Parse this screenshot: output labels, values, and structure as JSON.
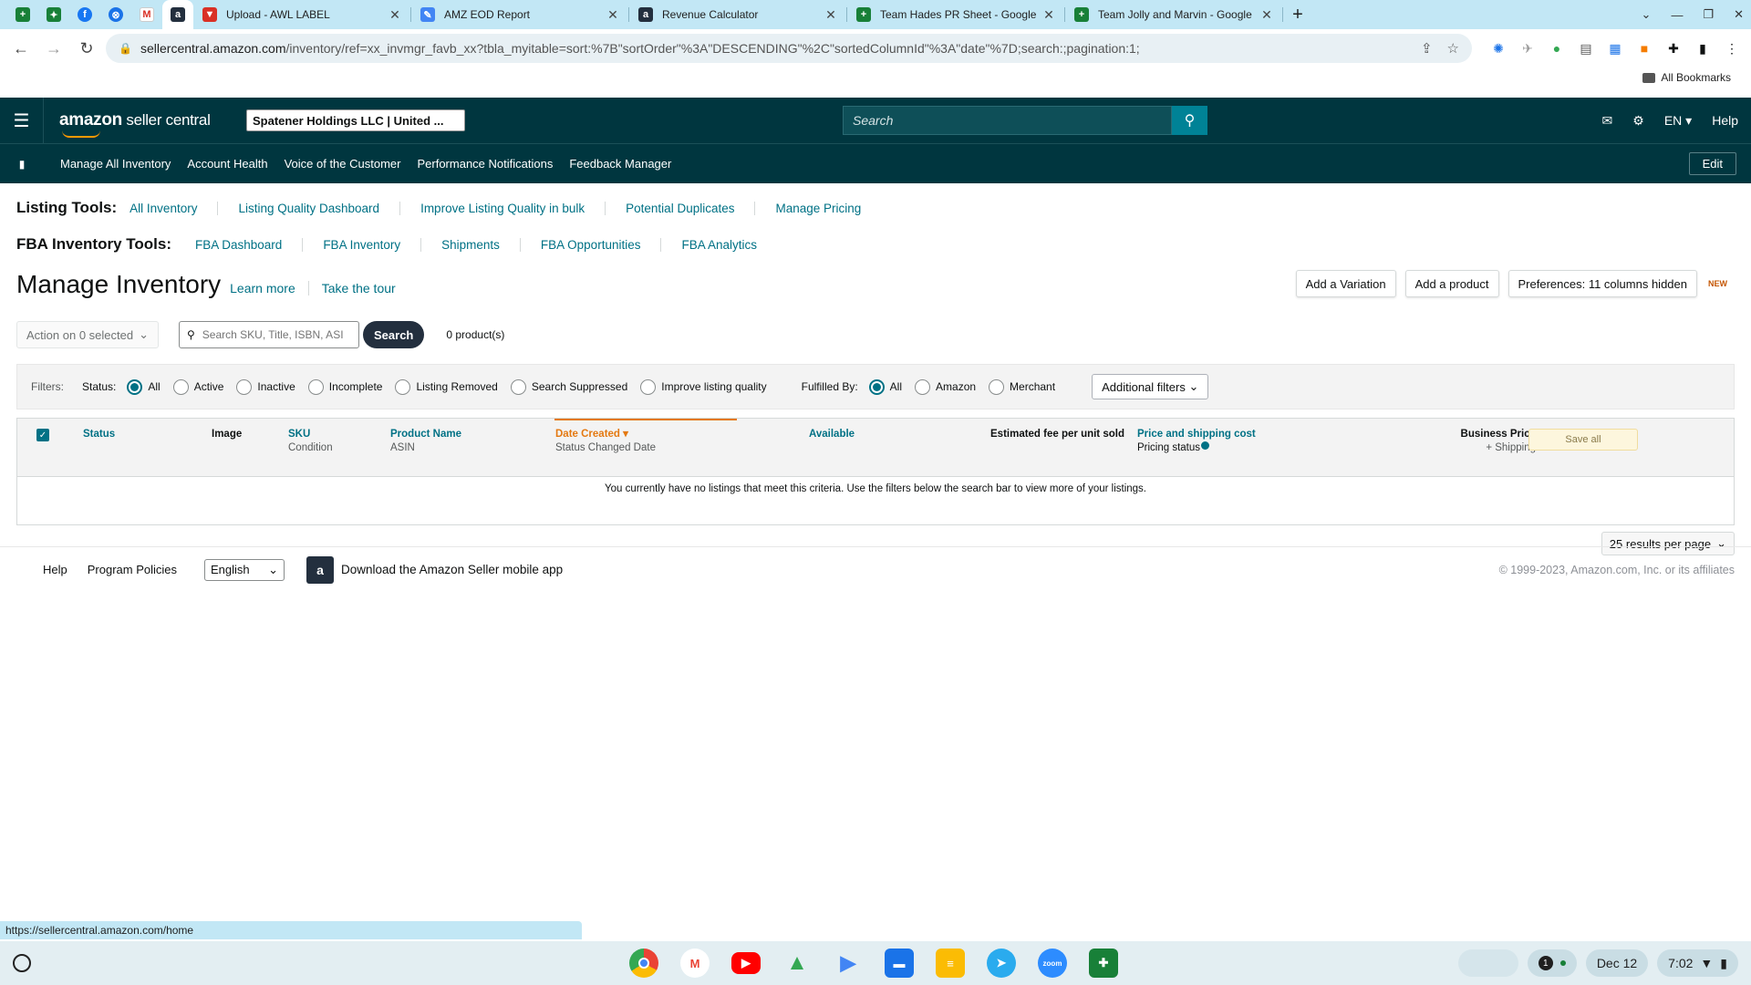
{
  "browser": {
    "tabs": [
      {
        "title": "Upload - AWL LABEL",
        "icon": "flag-icon",
        "color": "#d93025"
      },
      {
        "title": "AMZ EOD Report",
        "icon": "pen-icon",
        "color": "#4285f4"
      },
      {
        "title": "Revenue Calculator",
        "icon": "amazon-icon",
        "color": "#232f3e"
      },
      {
        "title": "Team Hades PR Sheet - Google",
        "icon": "sheets-icon",
        "color": "#188038"
      },
      {
        "title": "Team Jolly and Marvin - Google",
        "icon": "sheets-icon",
        "color": "#188038"
      }
    ],
    "url_domain": "sellercentral.amazon.com",
    "url_path": "/inventory/ref=xx_invmgr_favb_xx?tbla_myitable=sort:%7B\"sortOrder\"%3A\"DESCENDING\"%2C\"sortedColumnId\"%3A\"date\"%7D;search:;pagination:1;",
    "bookmarks_label": "All Bookmarks",
    "status_url": "https://sellercentral.amazon.com/home"
  },
  "header": {
    "logo_bold": "amazon",
    "logo_rest": " seller central",
    "store": "Spatener Holdings LLC | United ...",
    "search_placeholder": "Search",
    "lang": "EN",
    "help": "Help"
  },
  "nav": {
    "items": [
      "Manage All Inventory",
      "Account Health",
      "Voice of the Customer",
      "Performance Notifications",
      "Feedback Manager"
    ],
    "edit": "Edit"
  },
  "listing_tools": {
    "label": "Listing Tools:",
    "links": [
      "All Inventory",
      "Listing Quality Dashboard",
      "Improve Listing Quality in bulk",
      "Potential Duplicates",
      "Manage Pricing"
    ]
  },
  "fba_tools": {
    "label": "FBA Inventory Tools:",
    "links": [
      "FBA Dashboard",
      "FBA Inventory",
      "Shipments",
      "FBA Opportunities",
      "FBA Analytics"
    ]
  },
  "page": {
    "title": "Manage Inventory",
    "learn_more": "Learn more",
    "take_tour": "Take the tour",
    "add_variation": "Add a Variation",
    "add_product": "Add a product",
    "preferences": "Preferences: 11 columns hidden",
    "new_badge": "NEW",
    "action_select": "Action on 0 selected",
    "search_placeholder": "Search SKU, Title, ISBN, ASI",
    "search_btn": "Search",
    "product_count": "0 product(s)"
  },
  "filters": {
    "label": "Filters:",
    "status_label": "Status:",
    "status_options": [
      "All",
      "Active",
      "Inactive",
      "Incomplete",
      "Listing Removed",
      "Search Suppressed",
      "Improve listing quality"
    ],
    "status_selected": "All",
    "fulfilled_label": "Fulfilled By:",
    "fulfilled_options": [
      "All",
      "Amazon",
      "Merchant"
    ],
    "fulfilled_selected": "All",
    "additional": "Additional filters"
  },
  "table": {
    "columns": {
      "status": "Status",
      "image": "Image",
      "sku": "SKU",
      "condition": "Condition",
      "product_name": "Product Name",
      "asin": "ASIN",
      "date_created": "Date Created",
      "status_changed": "Status Changed Date",
      "available": "Available",
      "est_fee": "Estimated fee per unit sold",
      "price_shipping": "Price and shipping cost",
      "pricing_status": "Pricing status",
      "business_price": "Business Price",
      "plus_shipping": "+ Shipping"
    },
    "save_all": "Save all",
    "empty_message": "You currently have no listings that meet this criteria. Use the filters below the search bar to view more of your listings.",
    "per_page": "25 results per page"
  },
  "footer": {
    "help": "Help",
    "program_policies": "Program Policies",
    "language": "English",
    "app_text": "Download the Amazon Seller mobile app",
    "copyright": "© 1999-2023, Amazon.com, Inc. or its affiliates"
  },
  "shelf": {
    "date": "Dec 12",
    "time": "7:02",
    "notif": "1"
  }
}
